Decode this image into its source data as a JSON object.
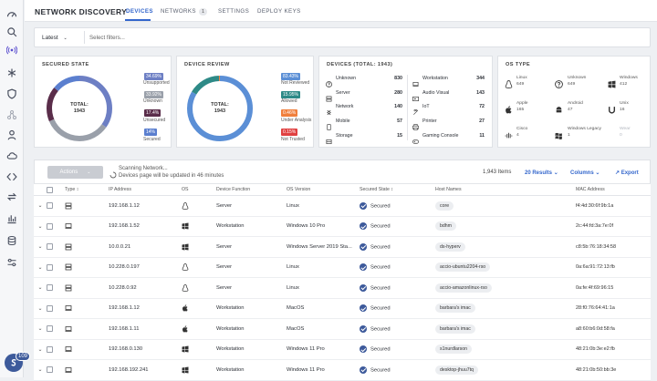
{
  "app": {
    "title": "NETWORK DISCOVERY"
  },
  "tabs": [
    {
      "label": "DEVICES",
      "active": true
    },
    {
      "label": "NETWORKS",
      "count": "1"
    },
    {
      "label": "SETTINGS"
    },
    {
      "label": "DEPLOY KEYS"
    }
  ],
  "filters": {
    "scope": "Latest",
    "placeholder": "Select filters..."
  },
  "secured_state": {
    "title": "SECURED STATE",
    "total_label": "TOTAL:",
    "total": "1943",
    "legend": [
      {
        "pct": "34.69%",
        "label": "Unsupported",
        "color": "#6d7fc4"
      },
      {
        "pct": "33.92%",
        "label": "Unknown",
        "color": "#9aa0aa"
      },
      {
        "pct": "17.4%",
        "label": "Unsecured",
        "color": "#5a2d4a"
      },
      {
        "pct": "14%",
        "label": "Secured",
        "color": "#5b7fcf"
      }
    ]
  },
  "device_review": {
    "title": "DEVICE REVIEW",
    "total_label": "TOTAL:",
    "total": "1943",
    "legend": [
      {
        "pct": "83.43%",
        "label": "Not Reviewed",
        "color": "#5b8fd6"
      },
      {
        "pct": "15.95%",
        "label": "Allowed",
        "color": "#2e8a87"
      },
      {
        "pct": "0.46%",
        "label": "Under Analysis",
        "color": "#f07f3c"
      },
      {
        "pct": "0.15%",
        "label": "Not Trusted",
        "color": "#e04040"
      }
    ]
  },
  "devices": {
    "title": "DEVICES (TOTAL: 1943)",
    "left": [
      {
        "icon": "question-icon",
        "label": "Unknown",
        "value": "830"
      },
      {
        "icon": "server-icon",
        "label": "Server",
        "value": "280"
      },
      {
        "icon": "network-icon",
        "label": "Network",
        "value": "140"
      },
      {
        "icon": "mobile-icon",
        "label": "Mobile",
        "value": "57"
      },
      {
        "icon": "storage-icon",
        "label": "Storage",
        "value": "15"
      }
    ],
    "right": [
      {
        "icon": "workstation-icon",
        "label": "Workstation",
        "value": "344"
      },
      {
        "icon": "audio-visual-icon",
        "label": "Audio Visual",
        "value": "143"
      },
      {
        "icon": "iot-icon",
        "label": "IoT",
        "value": "72"
      },
      {
        "icon": "printer-icon",
        "label": "Printer",
        "value": "27"
      },
      {
        "icon": "gaming-console-icon",
        "label": "Gaming Console",
        "value": "11"
      }
    ]
  },
  "os_type": {
    "title": "OS TYPE",
    "items": [
      {
        "icon": "linux-icon",
        "label": "Linux",
        "value": "649"
      },
      {
        "icon": "unknown-os-icon",
        "label": "Unknown",
        "value": "649"
      },
      {
        "icon": "windows-icon",
        "label": "Windows",
        "value": "412"
      },
      {
        "icon": "apple-icon",
        "label": "Apple",
        "value": "165"
      },
      {
        "icon": "android-icon",
        "label": "Android",
        "value": "47"
      },
      {
        "icon": "unix-icon",
        "label": "Unix",
        "value": "16"
      },
      {
        "icon": "cisco-icon",
        "label": "Cisco",
        "value": "4"
      },
      {
        "icon": "windows-legacy-icon",
        "label": "Windows Legacy",
        "value": "1"
      },
      {
        "icon": "wear-icon",
        "label": "Wear",
        "value": "0"
      }
    ]
  },
  "toolbar": {
    "actions": "Actions",
    "scan_line1": "Scanning Network...",
    "scan_line2": "Devices page will be updated in 46 minutes",
    "items": "1,943 Items",
    "results": "20 Results",
    "columns": "Columns",
    "export": "Export"
  },
  "table": {
    "headers": [
      "Type",
      "IP Address",
      "OS",
      "Device Function",
      "OS Version",
      "Secured State",
      "Host Names",
      "MAC Address"
    ],
    "rows": [
      {
        "type": "server",
        "ip": "192.168.1.12",
        "os": "linux",
        "func": "Server",
        "ver": "Linux",
        "state": "Secured",
        "host": "core",
        "mac": "f4:4d:30:6f:9b:1a"
      },
      {
        "type": "workstation",
        "ip": "192.168.1.52",
        "os": "windows",
        "func": "Workstation",
        "ver": "Windows 10 Pro",
        "state": "Secured",
        "host": "bdhm",
        "mac": "2c:44:fd:3a:7e:0f"
      },
      {
        "type": "server",
        "ip": "10.0.0.21",
        "os": "windows",
        "func": "Server",
        "ver": "Windows Server 2019 Sta...",
        "state": "Secured",
        "host": "ds-hyperv",
        "mac": "c8:5b:76:18:34:58"
      },
      {
        "type": "server",
        "ip": "10.228.0.197",
        "os": "linux",
        "func": "Server",
        "ver": "Linux",
        "state": "Secured",
        "host": "accio-ubuntu2204-rso",
        "mac": "0a:6a:91:72:13:fb"
      },
      {
        "type": "server",
        "ip": "10.228.0.92",
        "os": "linux",
        "func": "Server",
        "ver": "Linux",
        "state": "Secured",
        "host": "accio-amazonlinux-rso",
        "mac": "0a:fe:4f:69:96:15"
      },
      {
        "type": "workstation",
        "ip": "192.168.1.12",
        "os": "apple",
        "func": "Workstation",
        "ver": "MacOS",
        "state": "Secured",
        "host": "barbara's imac",
        "mac": "28:f0:76:64:41:1a"
      },
      {
        "type": "workstation",
        "ip": "192.168.1.11",
        "os": "apple",
        "func": "Workstation",
        "ver": "MacOS",
        "state": "Secured",
        "host": "barbara's imac",
        "mac": "a8:60:b6:0d:58:fa"
      },
      {
        "type": "workstation",
        "ip": "192.168.0.130",
        "os": "windows",
        "func": "Workstation",
        "ver": "Windows 11 Pro",
        "state": "Secured",
        "host": "s1nurdlarson",
        "mac": "48:21:0b:3e:e2:fb"
      },
      {
        "type": "workstation",
        "ip": "192.168.192.241",
        "os": "windows",
        "func": "Workstation",
        "ver": "Windows 11 Pro",
        "state": "Secured",
        "host": "desktop-jhuu7tq",
        "mac": "48:21:0b:50:bb:3e"
      }
    ]
  },
  "sidebar": {
    "badge_count": "109"
  },
  "colors": {
    "accent": "#3366cc",
    "secured": "#3d5a9b"
  }
}
